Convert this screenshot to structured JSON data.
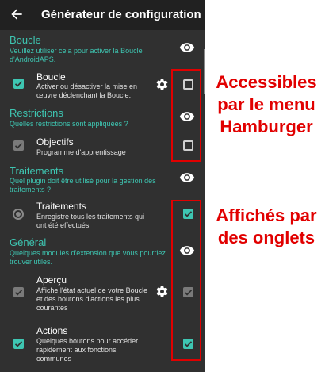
{
  "appbar": {
    "title": "Générateur de configuration",
    "back_icon": "arrow-back-icon"
  },
  "colors": {
    "accent": "#3ec6b2",
    "panel_bg": "#303030",
    "appbar_bg": "#212121",
    "annotation_red": "#e10000"
  },
  "sections": [
    {
      "title": "Boucle",
      "subtitle": "Veuillez utiliser cela pour activer la Boucle d'AndroidAPS.",
      "items": [
        {
          "title": "Boucle",
          "description": "Activer ou désactiver la mise en œuvre déclenchant la Boucle.",
          "left_checked": true,
          "has_settings": true,
          "right_checked": false
        }
      ]
    },
    {
      "title": "Restrictions",
      "subtitle": "Quelles restrictions sont appliquées ?",
      "items": [
        {
          "title": "Objectifs",
          "description": "Programme d'apprentissage",
          "left_checked": true,
          "left_disabled": true,
          "has_settings": false,
          "right_checked": false
        }
      ]
    },
    {
      "title": "Traitements",
      "subtitle": "Quel plugin doit être utilisé pour la gestion des traitements ?",
      "items": [
        {
          "title": "Traitements",
          "description": "Enregistre tous les traitements qui ont été effectués",
          "left_control": "radio",
          "has_settings": false,
          "right_checked": true
        }
      ]
    },
    {
      "title": "Général",
      "subtitle": "Quelques modules d'extension que vous pourriez trouver utiles.",
      "items": [
        {
          "title": "Aperçu",
          "description": "Affiche l'état actuel de votre Boucle et des boutons d'actions les plus courantes",
          "left_checked": true,
          "left_disabled": true,
          "has_settings": true,
          "right_checked": true,
          "right_disabled": true
        },
        {
          "title": "Actions",
          "description": "Quelques boutons pour accéder rapidement aux fonctions communes",
          "left_checked": true,
          "has_settings": false,
          "right_checked": true
        }
      ]
    }
  ],
  "annotations": {
    "top": [
      "Accessibles",
      "par le menu",
      "Hamburger"
    ],
    "bottom": [
      "Affichés par",
      "des onglets"
    ]
  }
}
